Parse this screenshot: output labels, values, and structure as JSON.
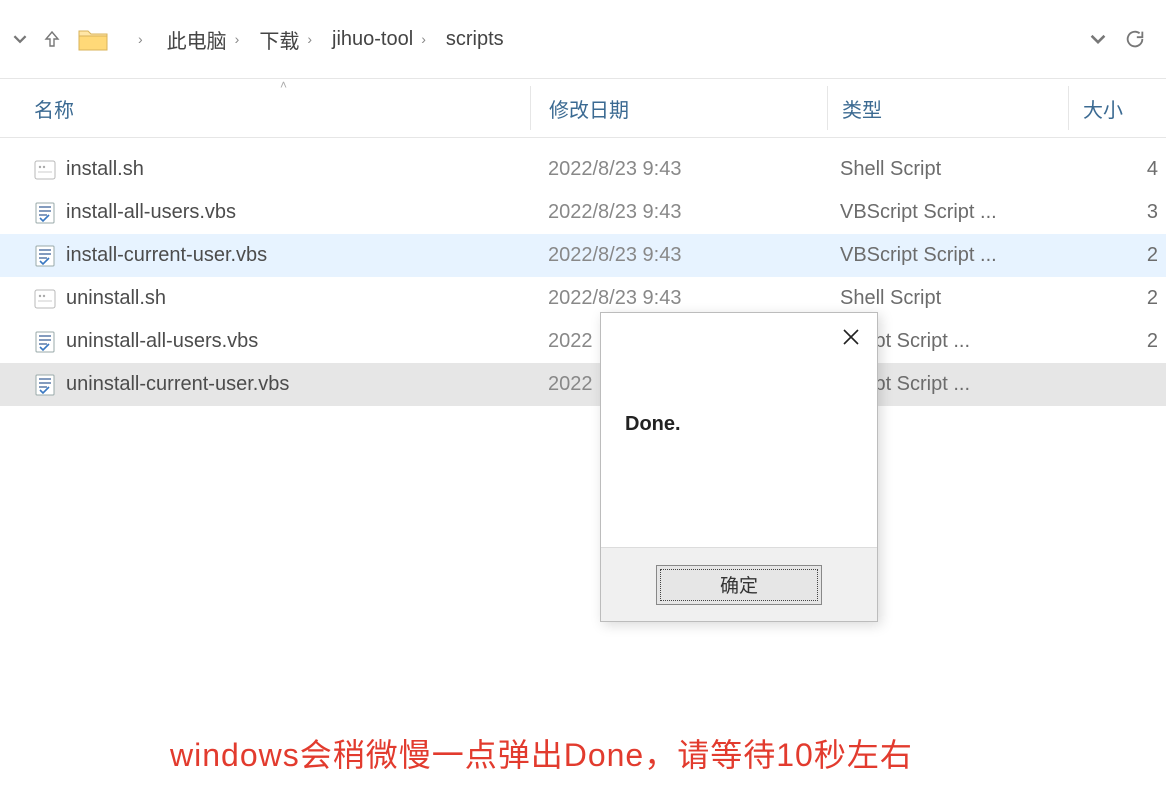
{
  "breadcrumb": {
    "items": [
      "此电脑",
      "下载",
      "jihuo-tool",
      "scripts"
    ]
  },
  "headers": {
    "name": "名称",
    "date": "修改日期",
    "type": "类型",
    "size": "大小"
  },
  "files": [
    {
      "name": "install.sh",
      "date": "2022/8/23 9:43",
      "type": "Shell Script",
      "size": "4",
      "icon": "sh",
      "state": ""
    },
    {
      "name": "install-all-users.vbs",
      "date": "2022/8/23 9:43",
      "type": "VBScript Script ...",
      "size": "3",
      "icon": "vbs",
      "state": ""
    },
    {
      "name": "install-current-user.vbs",
      "date": "2022/8/23 9:43",
      "type": "VBScript Script ...",
      "size": "2",
      "icon": "vbs",
      "state": "selected"
    },
    {
      "name": "uninstall.sh",
      "date": "2022/8/23 9:43",
      "type": "Shell Script",
      "size": "2",
      "icon": "sh",
      "state": ""
    },
    {
      "name": "uninstall-all-users.vbs",
      "date": "2022",
      "type": "Script Script ...",
      "size": "2",
      "icon": "vbs",
      "state": ""
    },
    {
      "name": "uninstall-current-user.vbs",
      "date": "2022",
      "type": "Script Script ...",
      "size": "",
      "icon": "vbs",
      "state": "hover"
    }
  ],
  "dialog": {
    "message": "Done.",
    "ok_label": "确定"
  },
  "annotation": "windows会稍微慢一点弹出Done，请等待10秒左右"
}
